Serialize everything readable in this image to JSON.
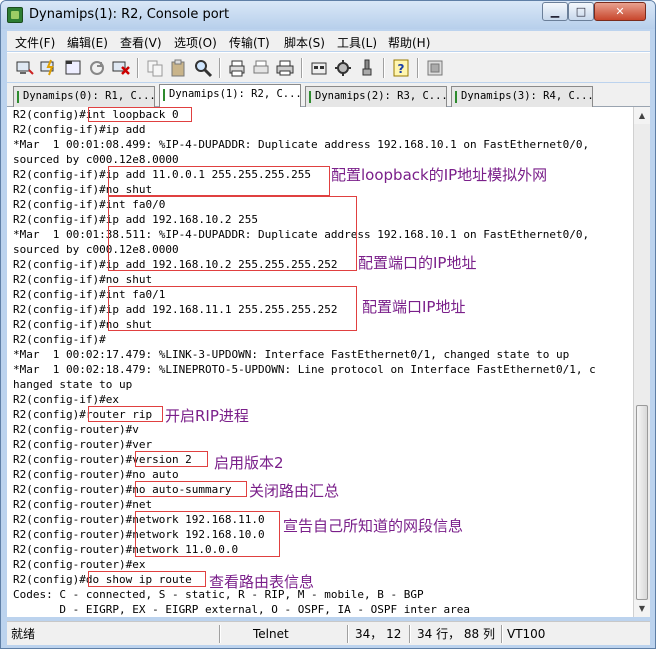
{
  "window": {
    "title": "Dynamips(1): R2, Console port",
    "minimize": "▁",
    "maximize": "□",
    "close": "✕"
  },
  "menu": [
    "文件(F)",
    "编辑(E)",
    "查看(V)",
    "选项(O)",
    "传输(T)",
    "脚本(S)",
    "工具(L)",
    "帮助(H)"
  ],
  "toolbar": {
    "icons": [
      "connect-icon",
      "quick-connect-icon",
      "connect-tab-icon",
      "reconnect-icon",
      "disconnect-icon",
      "copy-icon",
      "paste-icon",
      "find-icon",
      "print-setup-icon",
      "print-screen-icon",
      "print-icon",
      "session-options-icon",
      "global-options-icon",
      "keymap-icon",
      "help-icon",
      "clone-icon"
    ]
  },
  "tabs": [
    {
      "label": "Dynamips(0): R1, C...",
      "active": false
    },
    {
      "label": "Dynamips(1): R2, C...",
      "active": true
    },
    {
      "label": "Dynamips(2): R3, C...",
      "active": false
    },
    {
      "label": "Dynamips(3): R4, C...",
      "active": false
    }
  ],
  "terminal": {
    "lines": [
      "R2(config)#int loopback 0",
      "R2(config-if)#ip add",
      "*Mar  1 00:01:08.499: %IP-4-DUPADDR: Duplicate address 192.168.10.1 on FastEthernet0/0,",
      "sourced by c000.12e8.0000",
      "R2(config-if)#ip add 11.0.0.1 255.255.255.255",
      "R2(config-if)#no shut",
      "R2(config-if)#int fa0/0",
      "R2(config-if)#ip add 192.168.10.2 255",
      "*Mar  1 00:01:38.511: %IP-4-DUPADDR: Duplicate address 192.168.10.1 on FastEthernet0/0,",
      "sourced by c000.12e8.0000",
      "R2(config-if)#ip add 192.168.10.2 255.255.255.252",
      "R2(config-if)#no shut",
      "R2(config-if)#int fa0/1",
      "R2(config-if)#ip add 192.168.11.1 255.255.255.252",
      "R2(config-if)#no shut",
      "R2(config-if)#",
      "*Mar  1 00:02:17.479: %LINK-3-UPDOWN: Interface FastEthernet0/1, changed state to up",
      "*Mar  1 00:02:18.479: %LINEPROTO-5-UPDOWN: Line protocol on Interface FastEthernet0/1, c",
      "hanged state to up",
      "R2(config-if)#ex",
      "R2(config)#router rip",
      "R2(config-router)#v",
      "R2(config-router)#ver",
      "R2(config-router)#version 2",
      "R2(config-router)#no auto",
      "R2(config-router)#no auto-summary",
      "R2(config-router)#net",
      "R2(config-router)#network 192.168.11.0",
      "R2(config-router)#network 192.168.10.0",
      "R2(config-router)#network 11.0.0.0",
      "R2(config-router)#ex",
      "R2(config)#do show ip route",
      "Codes: C - connected, S - static, R - RIP, M - mobile, B - BGP",
      "       D - EIGRP, EX - EIGRP external, O - OSPF, IA - OSPF inter area"
    ]
  },
  "annotations": [
    {
      "text": "配置loopback的IP地址模拟外网"
    },
    {
      "text": "配置端口的IP地址"
    },
    {
      "text": "配置端口IP地址"
    },
    {
      "text": "开启RIP进程"
    },
    {
      "text": "启用版本2"
    },
    {
      "text": "关闭路由汇总"
    },
    {
      "text": "宣告自己所知道的网段信息"
    },
    {
      "text": "查看路由表信息"
    }
  ],
  "statusbar": {
    "ready": "就绪",
    "protocol": "Telnet",
    "position": "34， 12",
    "size": "34 行， 88 列",
    "emulation": "VT100"
  }
}
